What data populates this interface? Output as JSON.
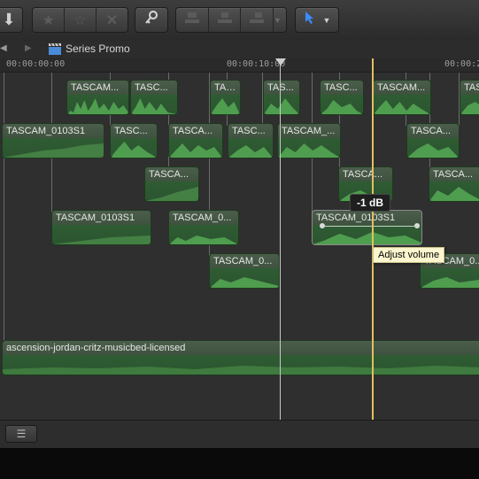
{
  "toolbar": {
    "import_icon": "download-arrow-icon",
    "rating_icons": [
      "favorite-star-filled-icon",
      "favorite-star-outline-icon",
      "reject-x-icon"
    ],
    "keyword_icon": "key-icon",
    "edit_icons": [
      "connect-clip-icon",
      "insert-clip-icon",
      "append-clip-icon"
    ],
    "tool_icon": "select-arrow-icon"
  },
  "pathbar": {
    "project_icon": "clapper-icon",
    "project_name": "Series Promo"
  },
  "ruler": {
    "t0": "00:00:00:00",
    "t1": "00:00:10:00",
    "t2": "00:00:2"
  },
  "clips": [
    {
      "label": "TASCAM..."
    },
    {
      "label": "TASC..."
    },
    {
      "label": "TAS..."
    },
    {
      "label": "TAS..."
    },
    {
      "label": "TASC..."
    },
    {
      "label": "TASCAM..."
    },
    {
      "label": "TAS"
    },
    {
      "label": "TASCAM_0103S1"
    },
    {
      "label": "TASC..."
    },
    {
      "label": "TASCA..."
    },
    {
      "label": "TASC..."
    },
    {
      "label": "TASCAM_..."
    },
    {
      "label": "TASCA..."
    },
    {
      "label": "TASCA..."
    },
    {
      "label": "TASCA..."
    },
    {
      "label": "TASCA..."
    },
    {
      "label": "TASCAM_0103S1"
    },
    {
      "label": "TASCAM_0..."
    },
    {
      "label": "TASCAM_0103S1"
    },
    {
      "label": "TASCAM_0..."
    },
    {
      "label": "TASCAM_0..."
    }
  ],
  "music_clip": "ascension-jordan-critz-musicbed-licensed",
  "volume_readout": "-1 dB",
  "tooltip": "Adjust volume",
  "bottom": {
    "index_icon": "timeline-index-icon"
  }
}
